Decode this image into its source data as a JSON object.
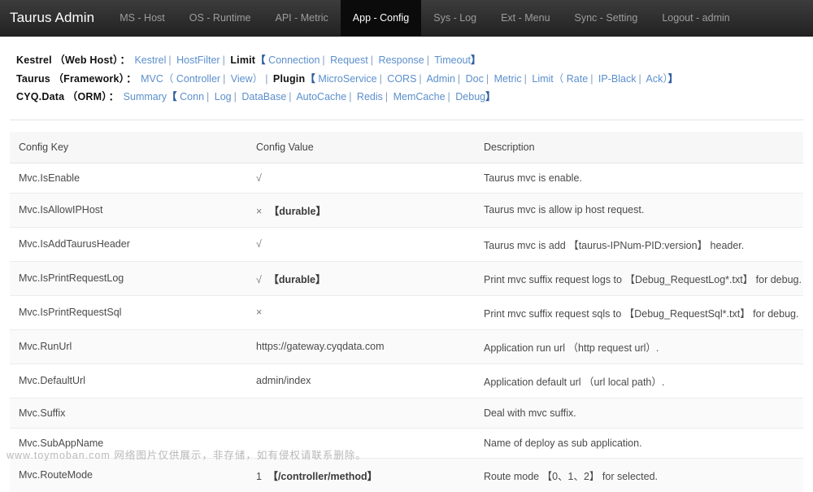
{
  "navbar": {
    "brand": "Taurus Admin",
    "items": [
      {
        "label": "MS - Host",
        "active": false
      },
      {
        "label": "OS - Runtime",
        "active": false
      },
      {
        "label": "API - Metric",
        "active": false
      },
      {
        "label": "App - Config",
        "active": true
      },
      {
        "label": "Sys - Log",
        "active": false
      },
      {
        "label": "Ext - Menu",
        "active": false
      },
      {
        "label": "Sync - Setting",
        "active": false
      },
      {
        "label": "Logout - admin",
        "active": false
      }
    ]
  },
  "linkbar": {
    "rows": [
      {
        "label": "Kestrel",
        "paren": "（Web Host）",
        "colon": "：",
        "tokens": [
          {
            "t": "link",
            "v": "Kestrel"
          },
          {
            "t": "sep",
            "v": "|"
          },
          {
            "t": "link",
            "v": "HostFilter"
          },
          {
            "t": "sep",
            "v": "|"
          },
          {
            "t": "bold",
            "v": "Limit"
          },
          {
            "t": "brk",
            "v": "【"
          },
          {
            "t": "link",
            "v": "Connection"
          },
          {
            "t": "sep",
            "v": "|"
          },
          {
            "t": "link",
            "v": "Request"
          },
          {
            "t": "sep",
            "v": "|"
          },
          {
            "t": "link",
            "v": "Response"
          },
          {
            "t": "sep",
            "v": "|"
          },
          {
            "t": "link",
            "v": "Timeout"
          },
          {
            "t": "brk",
            "v": "】"
          }
        ]
      },
      {
        "label": "Taurus",
        "paren": "（Framework）",
        "colon": "：",
        "tokens": [
          {
            "t": "link",
            "v": "MVC"
          },
          {
            "t": "pthin",
            "v": "（"
          },
          {
            "t": "link",
            "v": "Controller"
          },
          {
            "t": "sep",
            "v": "|"
          },
          {
            "t": "link",
            "v": "View"
          },
          {
            "t": "pthin",
            "v": "）"
          },
          {
            "t": "sep",
            "v": "|"
          },
          {
            "t": "bold",
            "v": "Plugin"
          },
          {
            "t": "brk",
            "v": "【"
          },
          {
            "t": "link",
            "v": "MicroService"
          },
          {
            "t": "sep",
            "v": "|"
          },
          {
            "t": "link",
            "v": "CORS"
          },
          {
            "t": "sep",
            "v": "|"
          },
          {
            "t": "link",
            "v": "Admin"
          },
          {
            "t": "sep",
            "v": "|"
          },
          {
            "t": "link",
            "v": "Doc"
          },
          {
            "t": "sep",
            "v": "|"
          },
          {
            "t": "link",
            "v": "Metric"
          },
          {
            "t": "sep",
            "v": "|"
          },
          {
            "t": "link",
            "v": "Limit"
          },
          {
            "t": "pthin",
            "v": "（"
          },
          {
            "t": "link",
            "v": "Rate"
          },
          {
            "t": "sep",
            "v": "|"
          },
          {
            "t": "link",
            "v": "IP-Black"
          },
          {
            "t": "sep",
            "v": "|"
          },
          {
            "t": "link",
            "v": "Ack"
          },
          {
            "t": "pthin",
            "v": "）"
          },
          {
            "t": "brk",
            "v": "】"
          }
        ]
      },
      {
        "label": "CYQ.Data",
        "paren": "（ORM）",
        "colon": "：",
        "tokens": [
          {
            "t": "link",
            "v": "Summary"
          },
          {
            "t": "brk",
            "v": "【"
          },
          {
            "t": "link",
            "v": "Conn"
          },
          {
            "t": "sep",
            "v": "|"
          },
          {
            "t": "link",
            "v": "Log"
          },
          {
            "t": "sep",
            "v": "|"
          },
          {
            "t": "link",
            "v": "DataBase"
          },
          {
            "t": "sep",
            "v": "|"
          },
          {
            "t": "link",
            "v": "AutoCache"
          },
          {
            "t": "sep",
            "v": "|"
          },
          {
            "t": "link",
            "v": "Redis"
          },
          {
            "t": "sep",
            "v": "|"
          },
          {
            "t": "link",
            "v": "MemCache"
          },
          {
            "t": "sep",
            "v": "|"
          },
          {
            "t": "link",
            "v": "Debug"
          },
          {
            "t": "brk",
            "v": "】"
          }
        ]
      }
    ]
  },
  "table": {
    "headers": [
      "Config Key",
      "Config Value",
      "Description"
    ],
    "rows": [
      {
        "key": "Mvc.IsEnable",
        "mark": "√",
        "value": "",
        "tag": "",
        "desc": "Taurus mvc is enable."
      },
      {
        "key": "Mvc.IsAllowIPHost",
        "mark": "×",
        "value": "",
        "tag": "【durable】",
        "desc": "Taurus mvc is allow ip host request."
      },
      {
        "key": "Mvc.IsAddTaurusHeader",
        "mark": "√",
        "value": "",
        "tag": "",
        "desc": "Taurus mvc is add 【taurus-IPNum-PID:version】 header."
      },
      {
        "key": "Mvc.IsPrintRequestLog",
        "mark": "√",
        "value": "",
        "tag": "【durable】",
        "desc": "Print mvc suffix request logs to 【Debug_RequestLog*.txt】 for debug."
      },
      {
        "key": "Mvc.IsPrintRequestSql",
        "mark": "×",
        "value": "",
        "tag": "",
        "desc": "Print mvc suffix request sqls to 【Debug_RequestSql*.txt】 for debug."
      },
      {
        "key": "Mvc.RunUrl",
        "mark": "",
        "value": "https://gateway.cyqdata.com",
        "tag": "",
        "desc": "Application run url （http request url）."
      },
      {
        "key": "Mvc.DefaultUrl",
        "mark": "",
        "value": "admin/index",
        "tag": "",
        "desc": "Application default url （url local path）."
      },
      {
        "key": "Mvc.Suffix",
        "mark": "",
        "value": "",
        "tag": "",
        "desc": "Deal with mvc suffix."
      },
      {
        "key": "Mvc.SubAppName",
        "mark": "",
        "value": "",
        "tag": "",
        "desc": "Name of deploy as sub application."
      },
      {
        "key": "Mvc.RouteMode",
        "mark": "",
        "value": "1",
        "tag": "【/controller/method】",
        "desc": "Route mode 【0、1、2】 for selected."
      }
    ]
  },
  "watermark": {
    "text": "www.toymoban.com 网络图片仅供展示，非存储，如有侵权请联系删除。"
  }
}
